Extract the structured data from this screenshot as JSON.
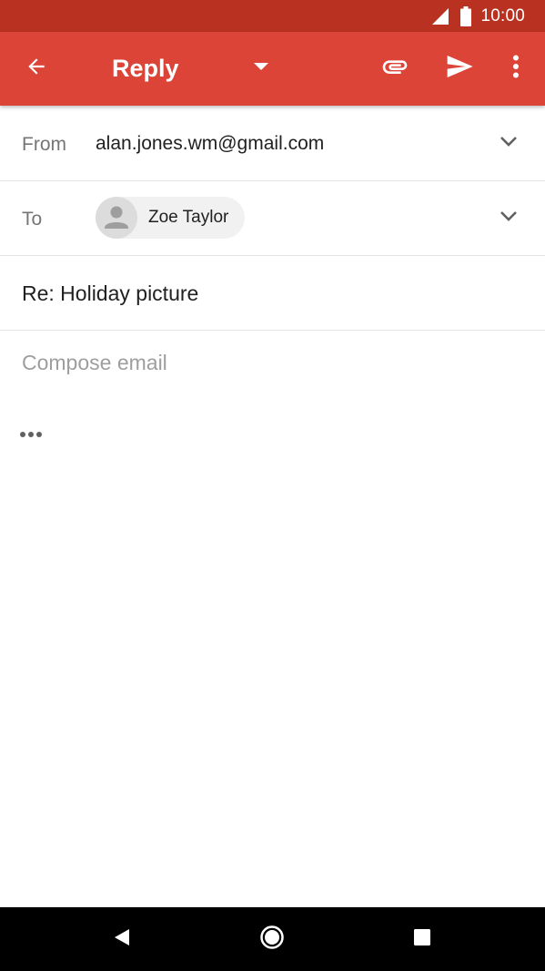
{
  "status_bar": {
    "time": "10:00",
    "icons": [
      "signal-icon",
      "battery-icon"
    ]
  },
  "app_bar": {
    "title": "Reply",
    "icons": [
      "back-arrow-icon",
      "dropdown-arrow-icon",
      "attachment-icon",
      "send-icon",
      "more-vert-icon"
    ],
    "background": "#db4437"
  },
  "from": {
    "label": "From",
    "value": "alan.jones.wm@gmail.com"
  },
  "to": {
    "label": "To",
    "recipient": "Zoe Taylor"
  },
  "subject": {
    "value": "Re: Holiday picture"
  },
  "compose": {
    "placeholder": "Compose email"
  },
  "nav_bar": {
    "icons": [
      "nav-back-icon",
      "nav-home-icon",
      "nav-recents-icon"
    ]
  },
  "colors": {
    "status_bar": "#b93221",
    "app_bar": "#db4437",
    "divider": "#e4e4e4",
    "label": "#757575",
    "placeholder": "#9e9e9e"
  }
}
